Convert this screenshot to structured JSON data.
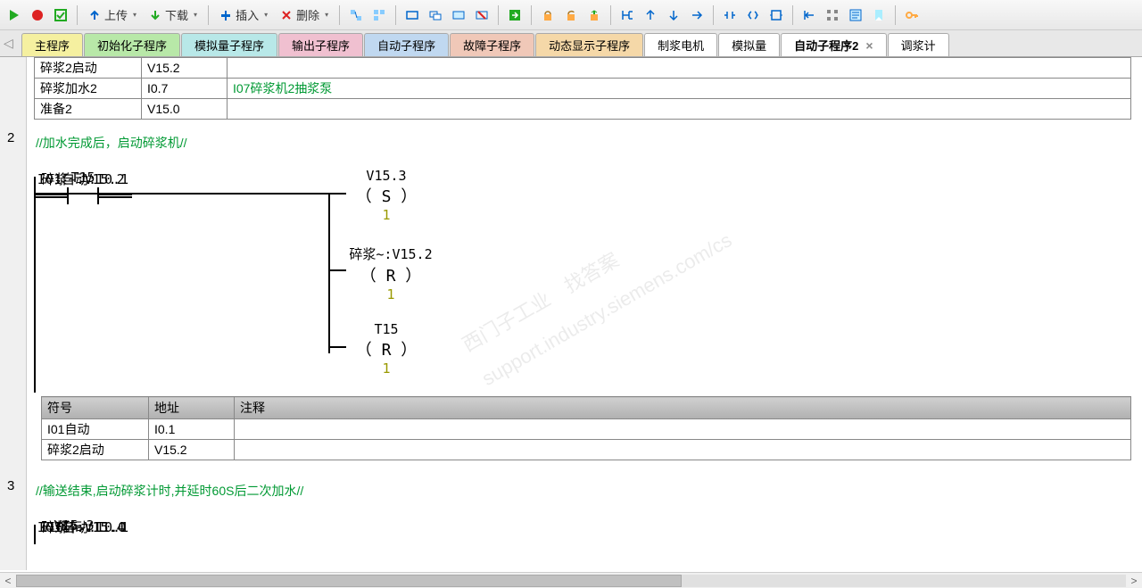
{
  "toolbar": {
    "upload": "上传",
    "download": "下载",
    "insert": "插入",
    "delete": "删除"
  },
  "tabs": [
    {
      "label": "主程序",
      "class": "c-yellow"
    },
    {
      "label": "初始化子程序",
      "class": "c-green"
    },
    {
      "label": "模拟量子程序",
      "class": "c-cyan"
    },
    {
      "label": "输出子程序",
      "class": "c-pink"
    },
    {
      "label": "自动子程序",
      "class": "c-blue"
    },
    {
      "label": "故障子程序",
      "class": "c-red"
    },
    {
      "label": "动态显示子程序",
      "class": "c-orange"
    },
    {
      "label": "制浆电机",
      "class": "c-white"
    },
    {
      "label": "模拟量",
      "class": "c-white"
    },
    {
      "label": "自动子程序2",
      "class": "c-white",
      "active": true
    },
    {
      "label": "调浆计",
      "class": "c-white"
    }
  ],
  "topTable": {
    "rows": [
      {
        "sym": "碎浆2启动",
        "addr": "V15.2",
        "comment": ""
      },
      {
        "sym": "碎浆加水2",
        "addr": "I0.7",
        "comment": "I07碎浆机2抽浆泵"
      },
      {
        "sym": "准备2",
        "addr": "V15.0",
        "comment": ""
      }
    ]
  },
  "network2": {
    "num": "2",
    "comment": "//加水完成后，启动碎浆机//",
    "contacts": [
      {
        "label": "I01自动:I0.1"
      },
      {
        "label": "T15"
      },
      {
        "label": "碎浆~:V15.2"
      }
    ],
    "coils": [
      {
        "label": "V15.3",
        "op": "S",
        "val": "1"
      },
      {
        "label": "碎浆~:V15.2",
        "op": "R",
        "val": "1"
      },
      {
        "label": "T15",
        "op": "R",
        "val": "1"
      }
    ]
  },
  "symTable2": {
    "headers": {
      "sym": "符号",
      "addr": "地址",
      "comment": "注释"
    },
    "rows": [
      {
        "sym": "I01自动",
        "addr": "I0.1",
        "comment": ""
      },
      {
        "sym": "碎浆2启动",
        "addr": "V15.2",
        "comment": ""
      }
    ]
  },
  "network3": {
    "num": "3",
    "comment": "//输送结束,启动碎浆计时,并延时60S后二次加水//",
    "contacts": [
      {
        "label": "I01自动:I0.1"
      },
      {
        "label": "V15.3"
      },
      {
        "label": "I10碎~:I1.0"
      },
      {
        "label": "碎浆~:V15.4"
      }
    ]
  },
  "watermark": "西门子工业　找答案\nsupport.industry.siemens.com/cs"
}
